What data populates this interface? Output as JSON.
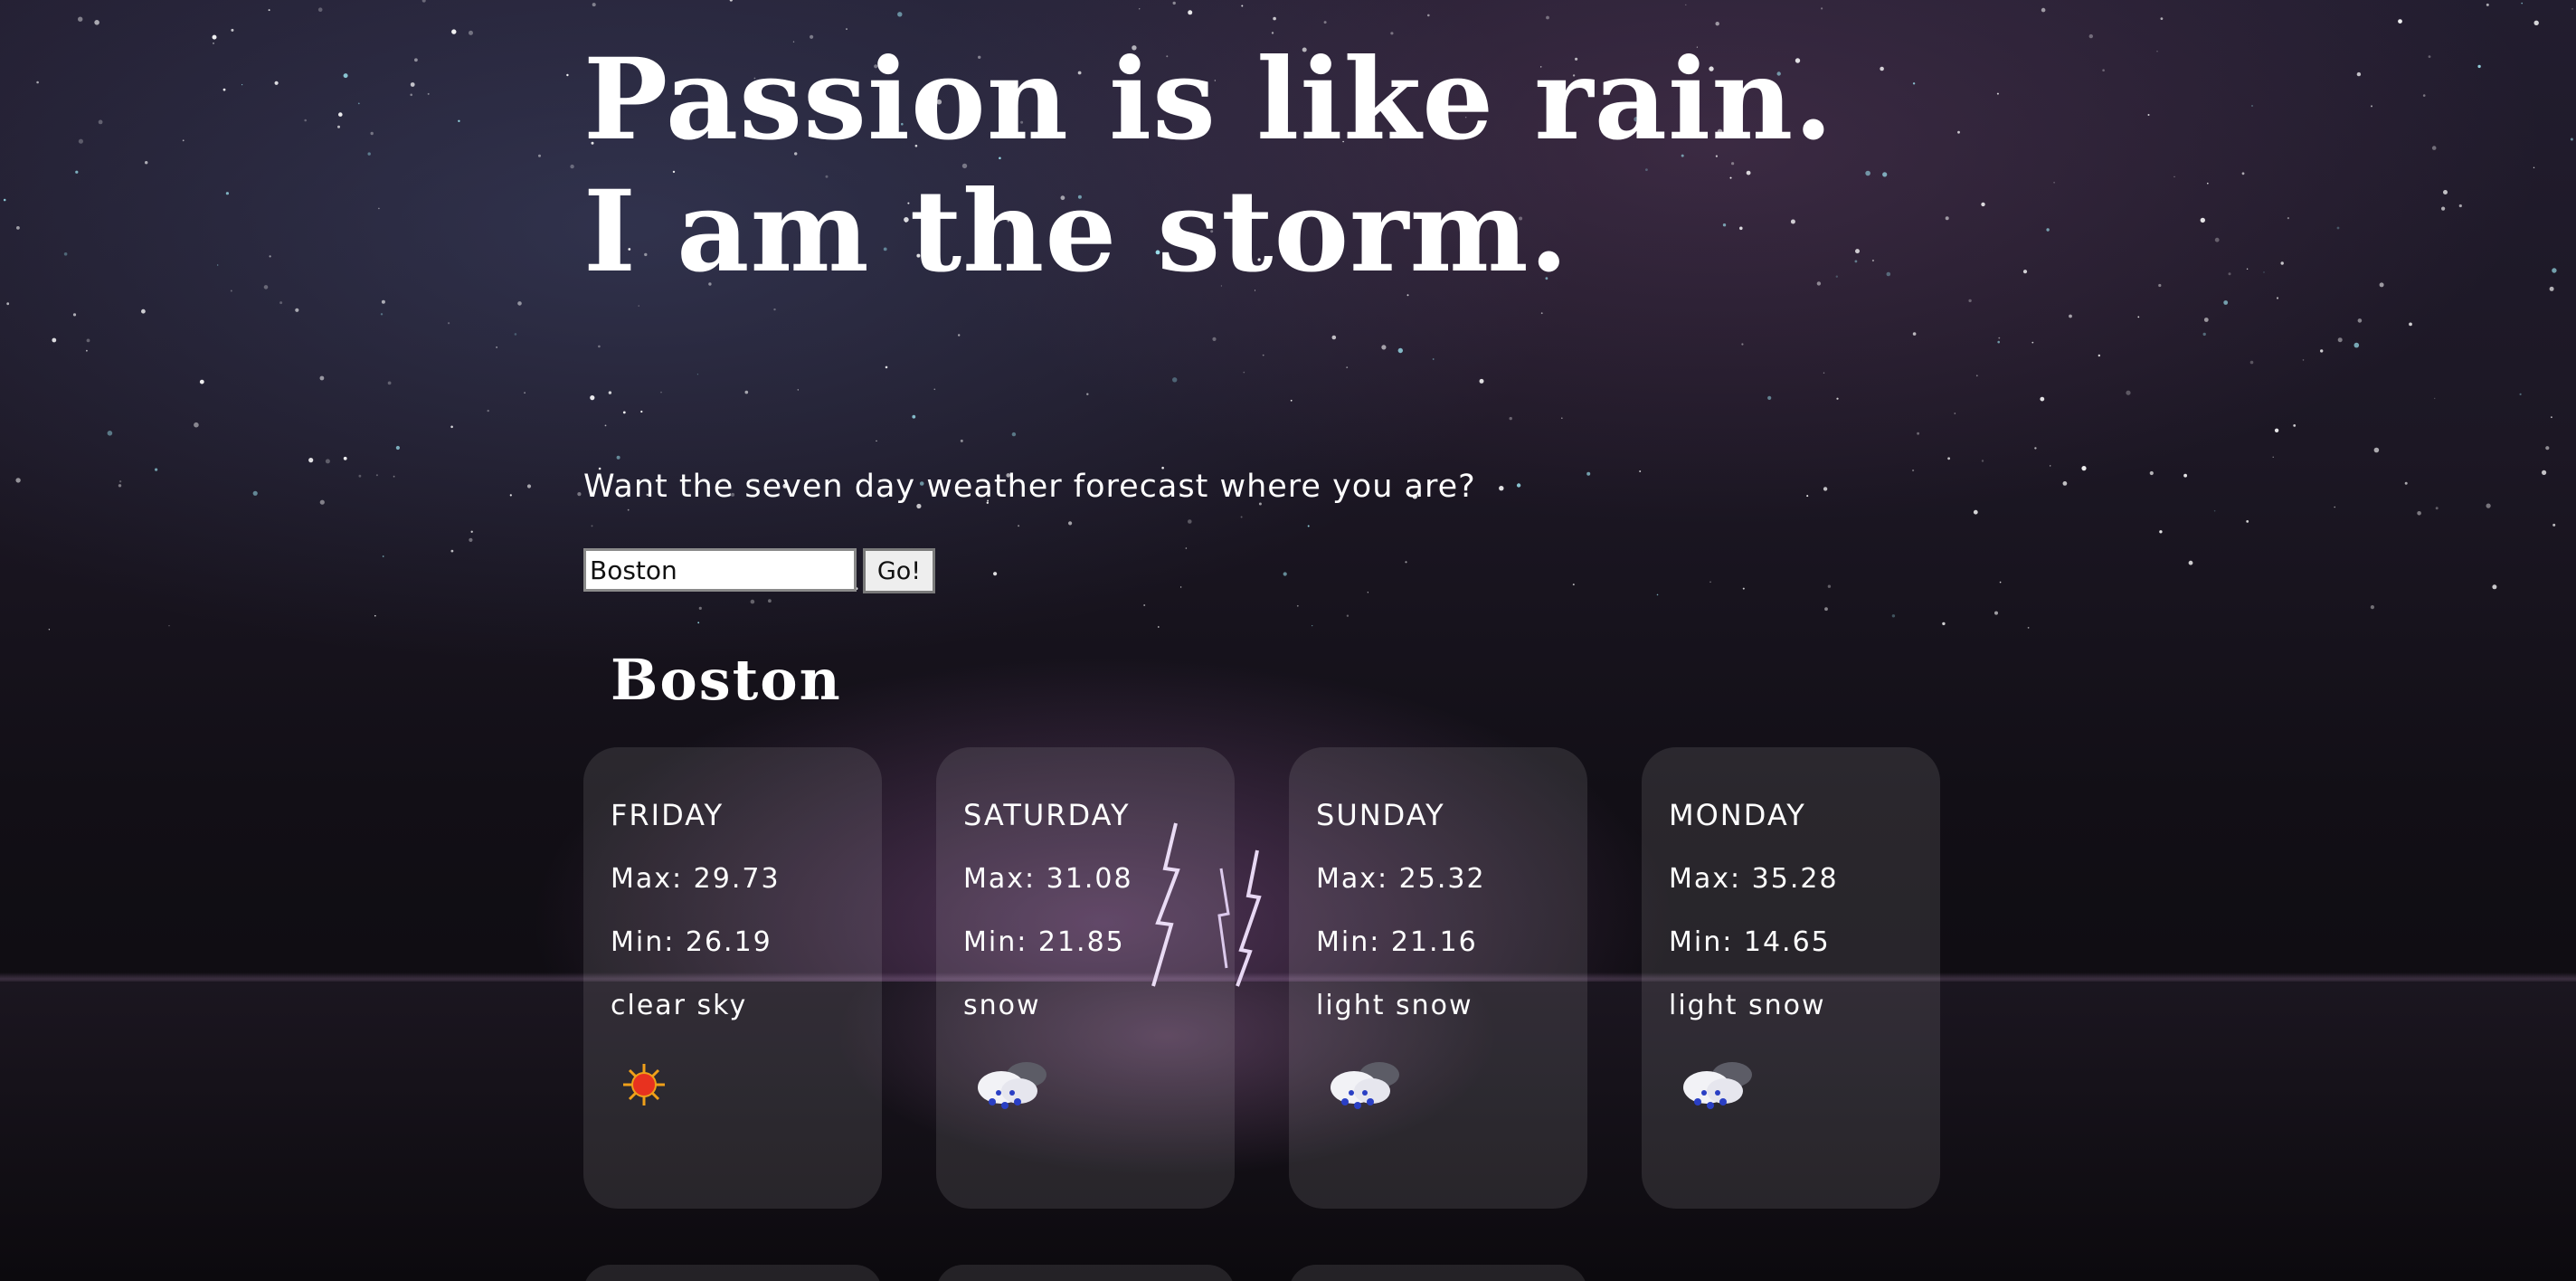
{
  "headline": {
    "line1": "Passion is like rain.",
    "line2": "I am the storm."
  },
  "search": {
    "prompt": "Want the seven day weather forecast where you are?",
    "value": "Boston",
    "button_label": "Go!"
  },
  "forecast": {
    "city": "Boston",
    "days": [
      {
        "day": "FRIDAY",
        "max": "Max: 29.73",
        "min": "Min: 26.19",
        "description": "clear sky",
        "icon": "sun-icon"
      },
      {
        "day": "SATURDAY",
        "max": "Max: 31.08",
        "min": "Min: 21.85",
        "description": "snow",
        "icon": "snow-cloud-icon"
      },
      {
        "day": "SUNDAY",
        "max": "Max: 25.32",
        "min": "Min: 21.16",
        "description": "light snow",
        "icon": "snow-cloud-icon"
      },
      {
        "day": "MONDAY",
        "max": "Max: 35.28",
        "min": "Min: 14.65",
        "description": "light snow",
        "icon": "snow-cloud-icon"
      }
    ]
  },
  "colors": {
    "card_background": "#ffffff1a",
    "text": "#ffffff",
    "sun": "#e8321f",
    "snow_flake": "#2a3fc4"
  }
}
